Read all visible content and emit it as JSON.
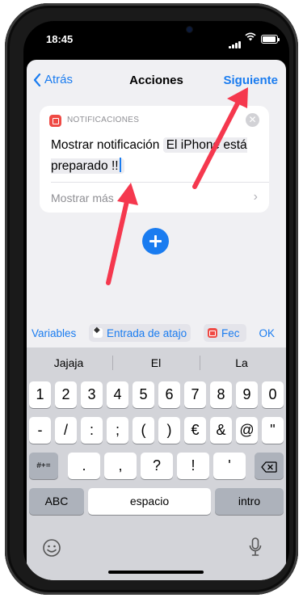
{
  "status": {
    "time": "18:45"
  },
  "nav": {
    "back": "Atrás",
    "title": "Acciones",
    "next": "Siguiente"
  },
  "card": {
    "category": "NOTIFICACIONES",
    "action": "Mostrar notificación",
    "text": "El iPhone está preparado !!",
    "more": "Mostrar más"
  },
  "variables": {
    "label": "Variables",
    "chip1": "Entrada de atajo",
    "chip2": "Fec",
    "ok": "OK"
  },
  "keyboard": {
    "suggestions": [
      "Jajaja",
      "El",
      "La"
    ],
    "row1": [
      "1",
      "2",
      "3",
      "4",
      "5",
      "6",
      "7",
      "8",
      "9",
      "0"
    ],
    "row2": [
      "-",
      "/",
      ":",
      ";",
      "(",
      ")",
      "€",
      "&",
      "@",
      "\""
    ],
    "row3": [
      ".",
      ",",
      "?",
      "!",
      "'"
    ],
    "switch_label": "#+=",
    "abc": "ABC",
    "space": "espacio",
    "return": "intro"
  },
  "icons": [
    "back-chevron-icon",
    "notification-app-icon",
    "clear-icon",
    "plus-icon",
    "delete-icon",
    "emoji-icon",
    "microphone-icon"
  ],
  "colors": {
    "accent": "#1a7cf0",
    "annotation_arrow": "#f5384e"
  }
}
